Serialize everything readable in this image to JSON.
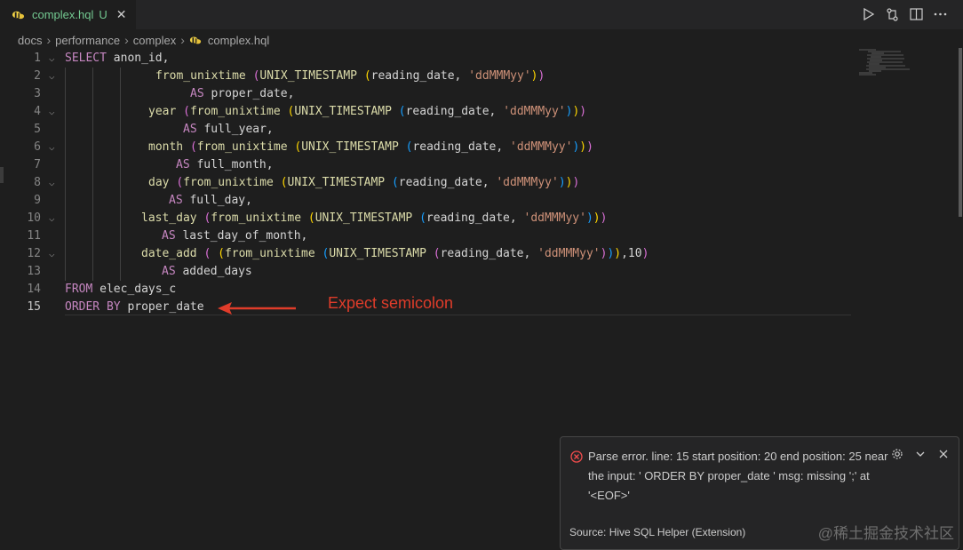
{
  "tab": {
    "filename": "complex.hql",
    "status": "U",
    "close": "✕"
  },
  "actions": {
    "run": "run-icon",
    "compare": "compare-changes-icon",
    "split": "split-editor-icon"
  },
  "breadcrumb": [
    "docs",
    "performance",
    "complex",
    "complex.hql"
  ],
  "annotation": "Expect semicolon",
  "hover": {
    "message": "Parse error. line: 15 start position: 20 end position: 25 near the input: ' ORDER BY proper_date ' msg: missing ';' at '<EOF>'",
    "source": "Source: Hive SQL Helper (Extension)"
  },
  "watermark": "@稀土掘金技术社区",
  "colors": {
    "error": "#f14c4c",
    "arrow": "#e03c2a",
    "keyword": "#c586c0",
    "function": "#dcdcaa",
    "string": "#ce9178"
  }
}
